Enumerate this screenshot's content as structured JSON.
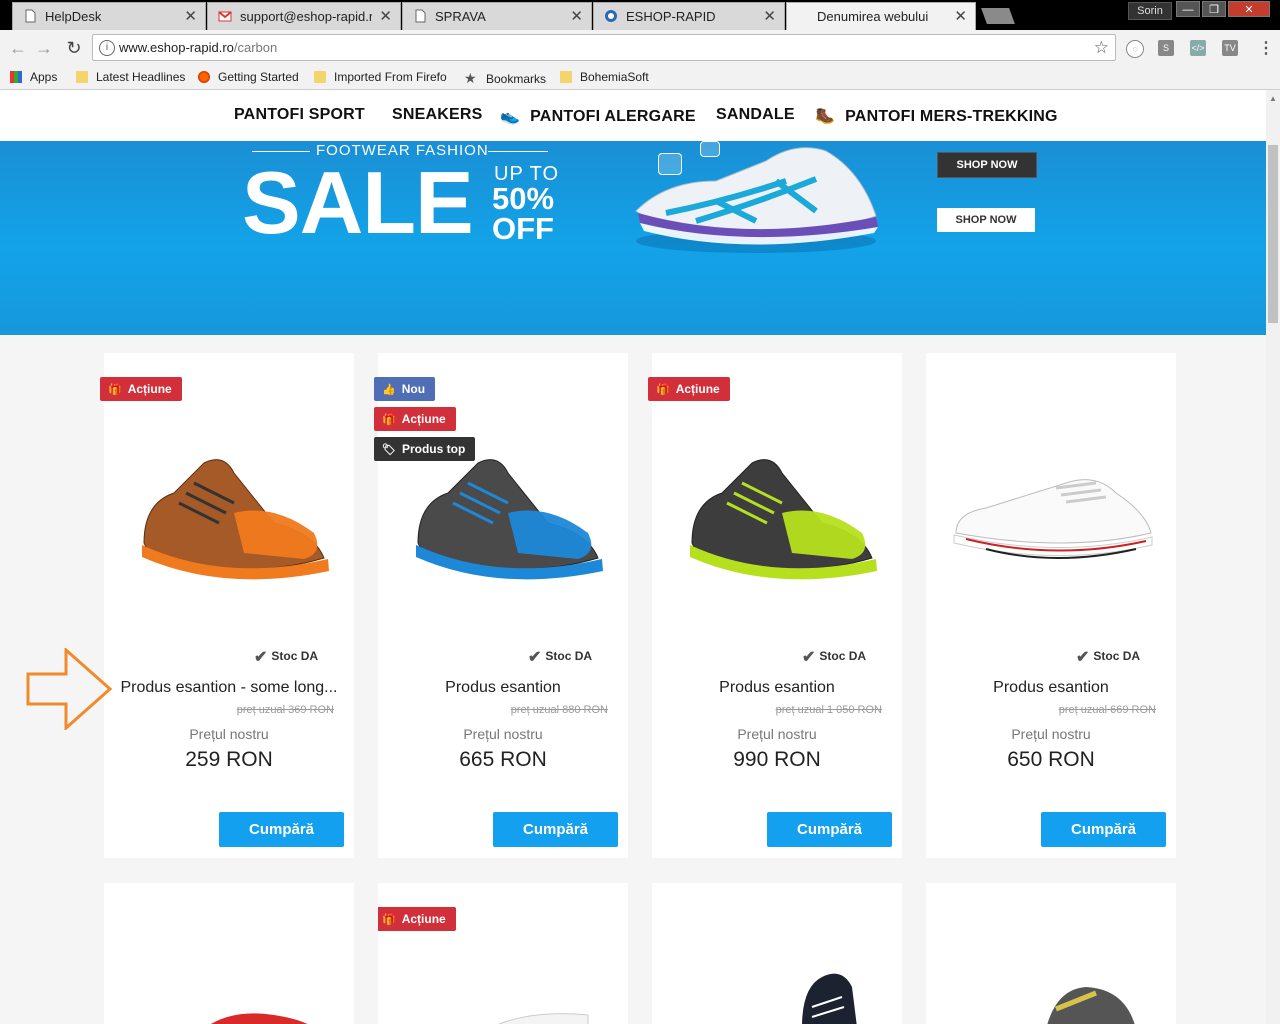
{
  "browser": {
    "tabs": [
      {
        "title": "HelpDesk",
        "icon": "doc-icon"
      },
      {
        "title": "support@eshop-rapid.ro",
        "icon": "gmail-icon"
      },
      {
        "title": "SPRAVA",
        "icon": "doc-icon"
      },
      {
        "title": "ESHOP-RAPID",
        "icon": "eshop-icon"
      },
      {
        "title": "Denumirea webului",
        "icon": "none"
      }
    ],
    "profile": "Sorin",
    "url_host": "www.eshop-rapid.ro",
    "url_path": "/carbon",
    "bookmarks": [
      "Apps",
      "Latest Headlines",
      "Getting Started",
      "Imported From Firefo",
      "Bookmarks",
      "BohemiaSoft"
    ]
  },
  "site": {
    "nav": [
      "PANTOFI SPORT",
      "SNEAKERS",
      "PANTOFI ALERGARE",
      "SANDALE",
      "PANTOFI MERS-TREKKING"
    ],
    "banner": {
      "kicker": "FOOTWEAR FASHION",
      "headline": "SALE",
      "upto": "UP TO",
      "percent": "50%",
      "off": "OFF",
      "cta1": "SHOP NOW",
      "cta2": "SHOP NOW"
    },
    "labels": {
      "stock": "Stoc DA",
      "our_price": "Prețul nostru",
      "buy": "Cumpără"
    },
    "badges": {
      "action": "Acțiune",
      "new": "Nou",
      "top": "Produs top"
    },
    "products": [
      {
        "name": "Produs esantion - some long...",
        "old_price": "preț uzual 369 RON",
        "price": "259 RON",
        "color": "#c0642a",
        "sole": "#f07a1e"
      },
      {
        "name": "Produs esantion",
        "old_price": "preț uzual 880 RON",
        "price": "665 RON",
        "color": "#4a4a4a",
        "sole": "#1e88d8"
      },
      {
        "name": "Produs esantion",
        "old_price": "preț uzual 1 050 RON",
        "price": "990 RON",
        "color": "#3d3d3d",
        "sole": "#b6e01e"
      },
      {
        "name": "Produs esantion",
        "old_price": "preț uzual 669 RON",
        "price": "650 RON",
        "color": "#ffffff",
        "sole": "#cc2222"
      }
    ]
  },
  "colors": {
    "accent": "#12a0ef",
    "badge_action": "#d12f3a",
    "badge_new": "#4f6eb5",
    "badge_top": "#333333",
    "annotation_arrow": "#f08a2a"
  }
}
